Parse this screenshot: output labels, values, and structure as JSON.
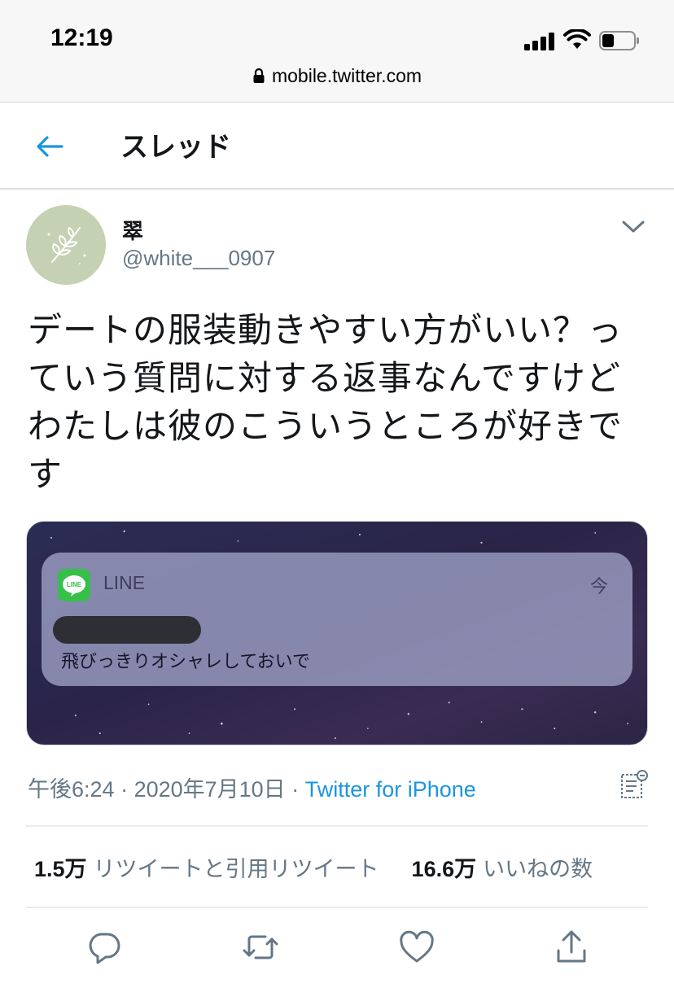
{
  "status_bar": {
    "time": "12:19",
    "url": "mobile.twitter.com"
  },
  "header": {
    "title": "スレッド",
    "back_icon": "arrow-left-icon"
  },
  "tweet": {
    "author_name": "翠",
    "author_handle": "@white___0907",
    "text": "デートの服装動きやすい方がいい？っていう質問に対する返事なんですけどわたしは彼のこういうところが好きです",
    "media": {
      "app_name": "LINE",
      "app_icon_label": "LINE",
      "notification_time": "今",
      "message": "飛びっきりオシャレしておいで"
    },
    "meta": {
      "time": "午後6:24",
      "date": "2020年7月10日",
      "source": "Twitter for iPhone"
    },
    "stats": {
      "retweets_value": "1.5万",
      "retweets_label": "リツイートと引用リツイート",
      "likes_value": "16.6万",
      "likes_label": "いいねの数"
    },
    "actions": [
      "reply-icon",
      "retweet-icon",
      "like-icon",
      "share-icon"
    ]
  },
  "colors": {
    "accent": "#1b95e0",
    "secondary_text": "#657786",
    "primary_text": "#14171a"
  }
}
